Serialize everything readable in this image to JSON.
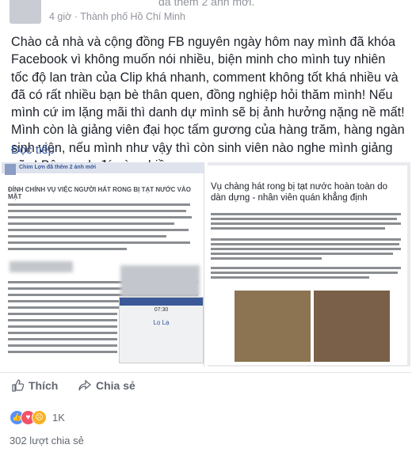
{
  "header": {
    "posted_suffix": "đã thêm 2 ảnh mới.",
    "time": "4 giờ",
    "separator": " · ",
    "location": "Thành phố Hồ Chí Minh"
  },
  "post": {
    "text": "Chào cả nhà và cộng đồng FB nguyên ngày hôm nay mình đã khóa Facebook vì không muốn nói nhiều, biện minh cho mình tuy nhiên tốc độ lan tràn của Clip khá nhanh, comment không tốt khá nhiều và đã có rất nhiều bạn bè thân quen, đồng nghiệp hỏi thăm mình! Nếu mình cứ im lặng mãi thì danh dự mình sẽ bị ảnh hưởng nặng nề mất! Mình còn là giảng viên đại học tấm gương của hàng trăm, hàng ngàn sinh viên, nếu mình như vậy thì còn sinh viên nào nghe mình giảng nữa! Bên cạnh đó còn nhiều...",
    "read_more": "Đọc tiếp"
  },
  "photo_left": {
    "mini_name": "Chim Lợn đã thêm 2 ảnh mới",
    "title": "ĐÍNH CHÍNH VỤ VIỆC NGƯỜI HÁT RONG BỊ TẠT NƯỚC VÀO MẶT",
    "phone_time": "07:30",
    "phone_label": "Lọ Lạ"
  },
  "photo_right": {
    "title": "Vụ chàng hát rong bị tạt nước hoàn toàn do dàn dựng - nhân viên quán khẳng định"
  },
  "actions": {
    "like_label": "Thích",
    "share_label": "Chia sẻ"
  },
  "reactions": {
    "count": "1K"
  },
  "shares": {
    "label": "302 lượt chia sẻ"
  },
  "colors": {
    "link": "#365899",
    "muted": "#90949c",
    "like": "#5890ff",
    "love": "#f25268",
    "sad": "#f7b125"
  }
}
